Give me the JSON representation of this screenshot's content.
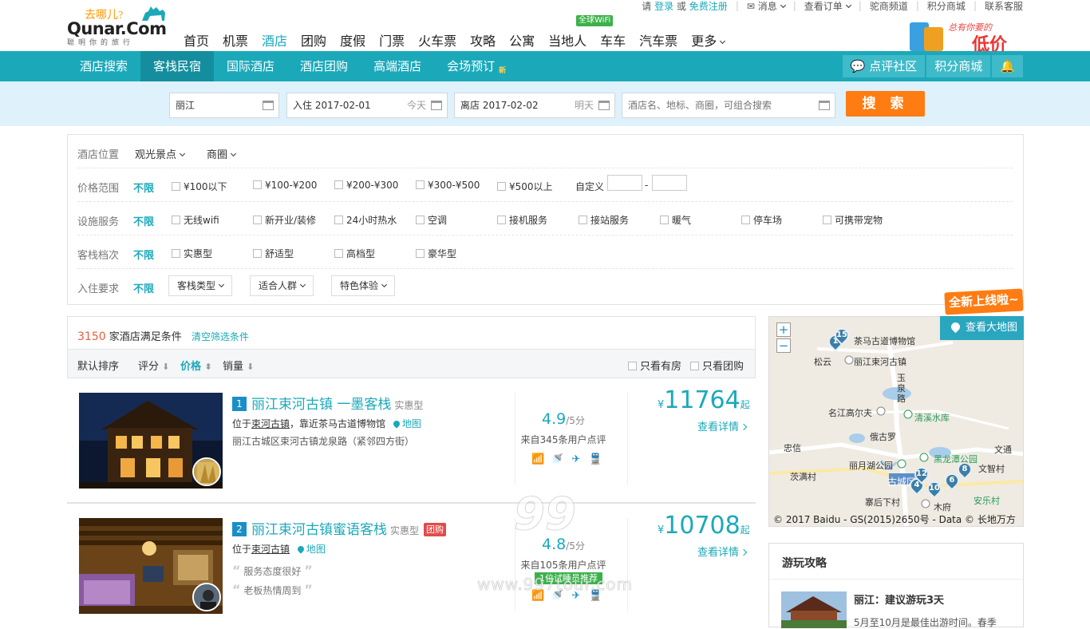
{
  "logo": {
    "slogan": "去哪儿?",
    "brand": "Qunar.Com",
    "tagline": "聪明你的旅行"
  },
  "top_links": {
    "login_prefix": "请",
    "login": "登录",
    "or": "或",
    "register": "免费注册",
    "messages": "消息",
    "orders": "查看订单",
    "camel_channel": "驼商频道",
    "points_mall": "积分商城",
    "contact": "联系客服"
  },
  "main_nav": [
    {
      "label": "首页"
    },
    {
      "label": "机票"
    },
    {
      "label": "酒店",
      "active": true
    },
    {
      "label": "团购"
    },
    {
      "label": "度假"
    },
    {
      "label": "门票"
    },
    {
      "label": "火车票"
    },
    {
      "label": "攻略"
    },
    {
      "label": "公寓"
    },
    {
      "label": "当地人"
    },
    {
      "label": "车车"
    },
    {
      "label": "汽车票"
    },
    {
      "label": "更多"
    }
  ],
  "wifi_badge": "全球WiFi",
  "promo": {
    "line1": "总有你要的",
    "line2": "低价"
  },
  "sub_nav": [
    {
      "label": "酒店搜索"
    },
    {
      "label": "客栈民宿",
      "active": true
    },
    {
      "label": "国际酒店"
    },
    {
      "label": "酒店团购"
    },
    {
      "label": "高端酒店"
    },
    {
      "label": "会场预订",
      "tag": "新"
    }
  ],
  "sub_right": {
    "community": "点评社区",
    "points": "积分商城"
  },
  "search": {
    "city": "丽江",
    "checkin_label": "入住",
    "checkin": "2017-02-01",
    "checkin_hint": "今天",
    "checkout_label": "离店",
    "checkout": "2017-02-02",
    "checkout_hint": "明天",
    "keyword_placeholder": "酒店名、地标、商圈，可组合搜索",
    "button": "搜 索"
  },
  "filters": {
    "location": {
      "label": "酒店位置",
      "options": [
        "观光景点",
        "商圈"
      ]
    },
    "price": {
      "label": "价格范围",
      "all": "不限",
      "options": [
        "¥100以下",
        "¥100-¥200",
        "¥200-¥300",
        "¥300-¥500",
        "¥500以上"
      ],
      "custom": "自定义",
      "dash": "-"
    },
    "facility": {
      "label": "设施服务",
      "all": "不限",
      "options": [
        "无线wifi",
        "新开业/装修",
        "24小时热水",
        "空调",
        "接机服务",
        "接站服务",
        "暖气",
        "停车场",
        "可携带宠物"
      ]
    },
    "grade": {
      "label": "客栈档次",
      "all": "不限",
      "options": [
        "实惠型",
        "舒适型",
        "高档型",
        "豪华型"
      ]
    },
    "requirement": {
      "label": "入住要求",
      "all": "不限",
      "dropdowns": [
        "客栈类型",
        "适合人群",
        "特色体验"
      ]
    }
  },
  "results": {
    "count": "3150",
    "count_suffix": "家酒店满足条件",
    "clear": "清空筛选条件"
  },
  "sort": {
    "default": "默认排序",
    "score": "评分",
    "price": "价格",
    "sales": "销量",
    "only_available": "只看有房",
    "only_group": "只看团购"
  },
  "hotels": [
    {
      "rank": "1",
      "name": "丽江束河古镇 一墨客栈",
      "type": "实惠型",
      "loc_prefix": "位于",
      "area": "束河古镇",
      "near": "，靠近茶马古道博物馆",
      "map": "地图",
      "address": "丽江古城区束河古镇龙泉路（紧邻四方街）",
      "score": "4.9",
      "score_max": "/5分",
      "reviews": "来自345条用户点评",
      "price_cur": "¥",
      "price": "11764",
      "price_suffix": "起",
      "detail": "查看详情"
    },
    {
      "rank": "2",
      "name": "丽江束河古镇蜜语客栈",
      "type": "实惠型",
      "tag": "团购",
      "loc_prefix": "位于",
      "area": "束河古镇",
      "map": "地图",
      "quote1": "服务态度很好",
      "quote2": "老板热情周到",
      "score": "4.8",
      "score_max": "/5分",
      "reviews": "来自105条用户点评",
      "promo": "1位试睡员推荐",
      "price_cur": "¥",
      "price": "10708",
      "price_suffix": "起",
      "detail": "查看详情"
    }
  ],
  "map": {
    "new_badge": "全新上线啦~",
    "view_big": "查看大地图",
    "zoom_in": "+",
    "zoom_out": "−",
    "copyright": "© 2017 Baidu - GS(2015)2650号 - Data © 长地万方",
    "labels": [
      "茶马古道博物馆",
      "松云",
      "丽江束河古镇",
      "玉泉路",
      "名江高尔夫",
      "清溪水库",
      "忠信",
      "俄古罗",
      "黑龙潭公园",
      "文通",
      "丽月湖公园",
      "文智村",
      "茨满村",
      "古城区",
      "寨后下村",
      "木府",
      "安乐村"
    ],
    "markers": [
      "1",
      "15",
      "4",
      "12",
      "10",
      "6",
      "8"
    ]
  },
  "guide": {
    "title": "游玩攻略",
    "item_title": "丽江：建议游玩3天",
    "item_desc": "5月至10月是最佳出游时间。春季"
  },
  "watermark": {
    "mark": "99",
    "site": "www.997tour.com"
  }
}
